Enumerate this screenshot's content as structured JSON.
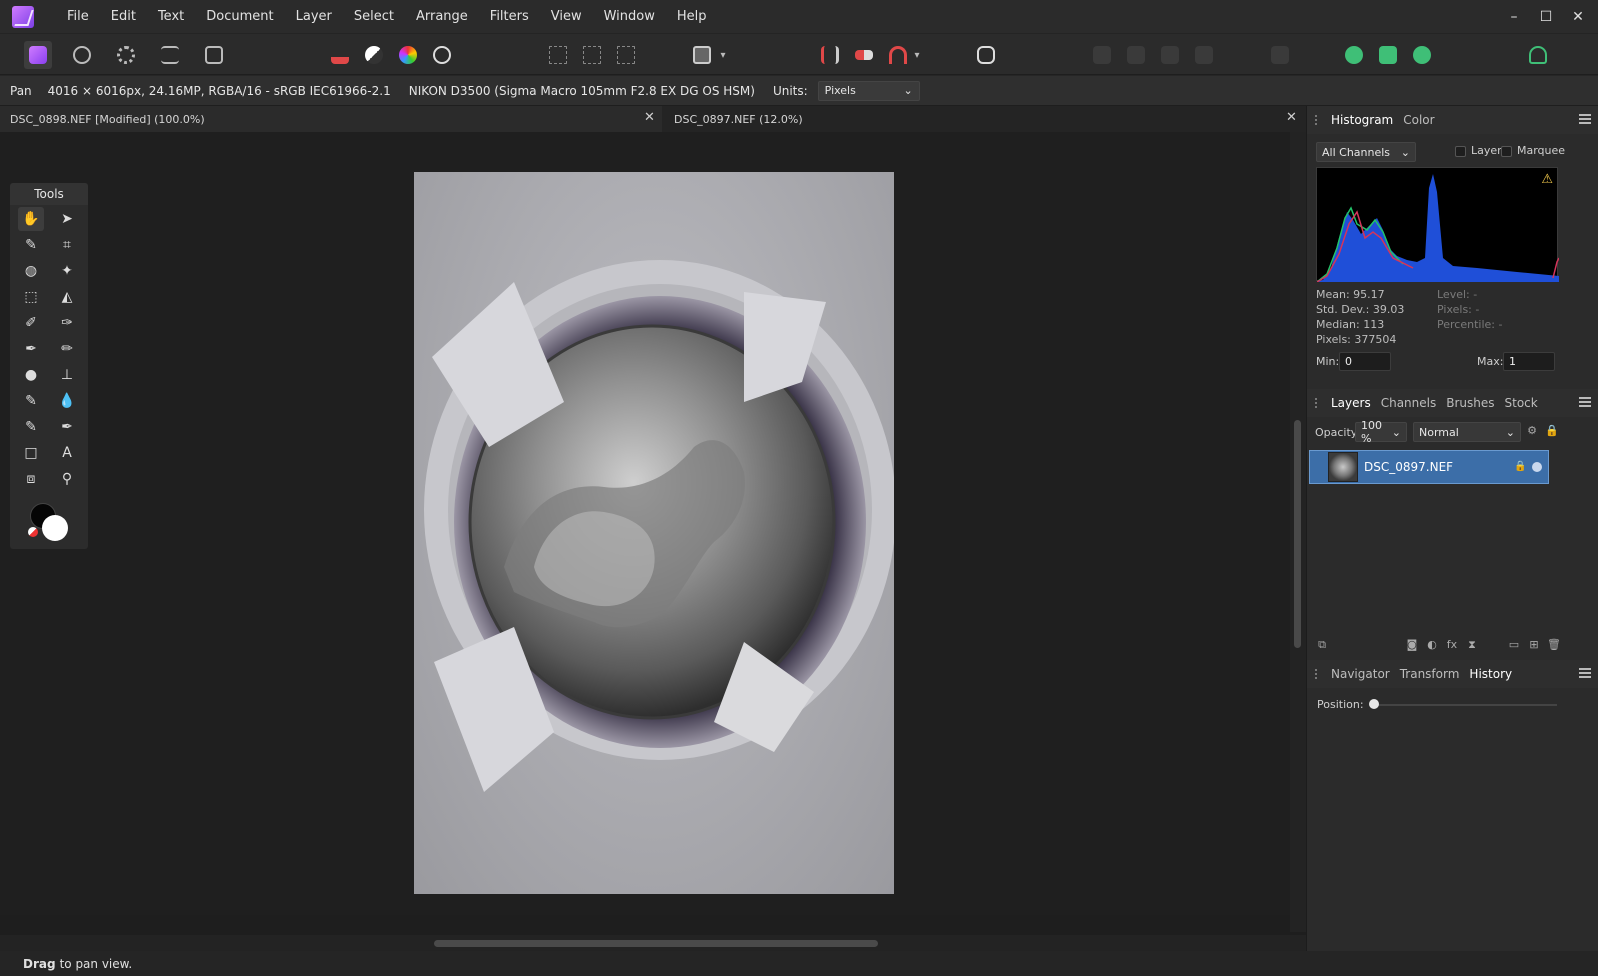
{
  "menubar": {
    "items": [
      "File",
      "Edit",
      "Text",
      "Document",
      "Layer",
      "Select",
      "Arrange",
      "Filters",
      "View",
      "Window",
      "Help"
    ],
    "window_controls": [
      "–",
      "☐",
      "✕"
    ]
  },
  "context": {
    "tool": "Pan",
    "image_info": "4016 × 6016px, 24.16MP, RGBA/16 - sRGB IEC61966-2.1",
    "camera": "NIKON D3500 (Sigma Macro 105mm F2.8 EX DG OS HSM)",
    "units_label": "Units:",
    "units_value": "Pixels"
  },
  "tabs": [
    {
      "label": "DSC_0898.NEF [Modified] (100.0%)",
      "close": "✕"
    },
    {
      "label": "DSC_0897.NEF (12.0%)",
      "close": "✕"
    }
  ],
  "tools": {
    "title": "Tools",
    "items": [
      {
        "icon": "hand-icon",
        "glyph": "✋"
      },
      {
        "icon": "pointer-icon",
        "glyph": "➤"
      },
      {
        "icon": "color-picker-icon",
        "glyph": "✎"
      },
      {
        "icon": "crop-icon",
        "glyph": "⌗"
      },
      {
        "icon": "selection-brush-icon",
        "glyph": "◍"
      },
      {
        "icon": "magic-wand-icon",
        "glyph": "✦"
      },
      {
        "icon": "marquee-icon",
        "glyph": "⬚"
      },
      {
        "icon": "flood-fill-icon",
        "glyph": "◭"
      },
      {
        "icon": "paint-brush-icon",
        "glyph": "✐"
      },
      {
        "icon": "erase-brush-icon",
        "glyph": "✑"
      },
      {
        "icon": "dodge-brush-icon",
        "glyph": "✒"
      },
      {
        "icon": "eraser-icon",
        "glyph": "✏"
      },
      {
        "icon": "blur-brush-icon",
        "glyph": "●"
      },
      {
        "icon": "clone-brush-icon",
        "glyph": "⊥"
      },
      {
        "icon": "inpainting-brush-icon",
        "glyph": "✎"
      },
      {
        "icon": "sharpen-brush-icon",
        "glyph": "💧"
      },
      {
        "icon": "red-eye-icon",
        "glyph": "✎"
      },
      {
        "icon": "pen-icon",
        "glyph": "✒"
      },
      {
        "icon": "rectangle-icon",
        "glyph": "□"
      },
      {
        "icon": "text-icon",
        "glyph": "A"
      },
      {
        "icon": "mesh-warp-icon",
        "glyph": "⧈"
      },
      {
        "icon": "zoom-icon",
        "glyph": "⚲"
      }
    ]
  },
  "histogram_panel": {
    "tabs": [
      "Histogram",
      "Color"
    ],
    "channel": "All Channels",
    "layer_label": "Layer",
    "marquee_label": "Marquee",
    "warning": "⚠",
    "stats_left": [
      "Mean: 95.17",
      "Std. Dev.: 39.03",
      "Median: 113",
      "Pixels: 377504"
    ],
    "stats_right": [
      "Level: -",
      "Pixels: -",
      "Percentile: -"
    ],
    "min_label": "Min:",
    "min_value": "0",
    "max_label": "Max:",
    "max_value": "1"
  },
  "layers_panel": {
    "tabs": [
      "Layers",
      "Channels",
      "Brushes",
      "Stock"
    ],
    "opacity_label": "Opacity:",
    "opacity_value": "100 %",
    "blend_mode": "Normal",
    "layer_name": "DSC_0897.NEF"
  },
  "history_panel": {
    "tabs": [
      "Navigator",
      "Transform",
      "History"
    ],
    "position_label": "Position:"
  },
  "status": {
    "strong": "Drag",
    "text": "to pan view."
  },
  "colors": {
    "accent": "#3c6ea8",
    "app_brand": "#9b4dff",
    "histogram_blue": "#1f4fd8"
  }
}
